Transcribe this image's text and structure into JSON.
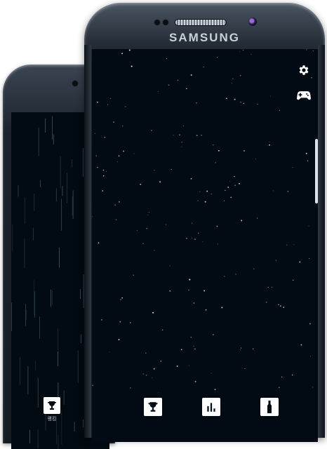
{
  "device": {
    "brand": "SAMSUNG"
  },
  "back_screen": {
    "tabs": [
      {
        "label": "랭킹",
        "icon": "trophy-icon"
      }
    ]
  },
  "front_screen": {
    "top_icons": [
      "gear-icon",
      "gamepad-icon"
    ],
    "tabs": [
      {
        "icon": "trophy-icon"
      },
      {
        "icon": "bar-chart-icon"
      },
      {
        "icon": "bottle-icon"
      }
    ]
  },
  "colors": {
    "screen_background": "#020b13",
    "icon_color": "#ffffff",
    "tab_background": "#ffffff",
    "tab_icon": "#020b13"
  }
}
